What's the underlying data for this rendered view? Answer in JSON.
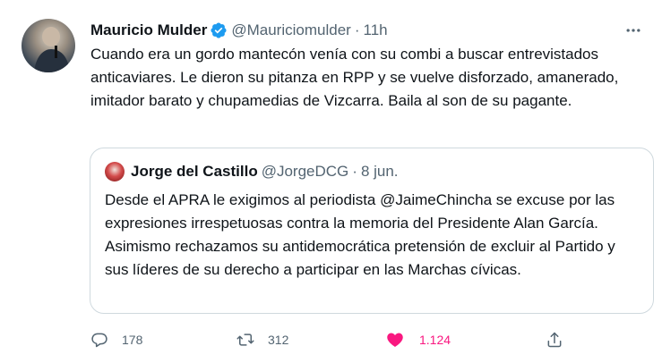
{
  "tweet": {
    "author_name": "Mauricio Mulder",
    "handle": "@Mauriciomulder",
    "separator": "·",
    "time": "11h",
    "text": "Cuando era un gordo mantecón venía con su combi a buscar entrevistados anticaviares. Le dieron su pitanza en RPP y se vuelve disforzado, amanerado, imitador barato y chupamedias de Vizcarra. Baila al son de su pagante."
  },
  "quoted_tweet": {
    "author_name": "Jorge del Castillo",
    "handle": "@JorgeDCG",
    "separator": "·",
    "date": "8 jun.",
    "paragraph1": "Desde el APRA le exigimos al periodista @JaimeChincha se excuse por las expresiones irrespetuosas contra la memoria del Presidente Alan García.",
    "paragraph2": "Asimismo rechazamos su antidemocrática pretensión de excluir al Partido y sus líderes de su derecho a participar en las Marchas cívicas."
  },
  "actions": {
    "replies": "178",
    "retweets": "312",
    "likes": "1.124"
  },
  "icons": {
    "verified": "verified-badge-icon",
    "more": "more-horizontal-icon",
    "reply": "reply-icon",
    "retweet": "retweet-icon",
    "like": "heart-filled-icon",
    "share": "share-icon"
  },
  "colors": {
    "verified": "#1d9bf0",
    "like": "#f91880",
    "secondary_text": "#536471",
    "border": "#cfd9de"
  }
}
